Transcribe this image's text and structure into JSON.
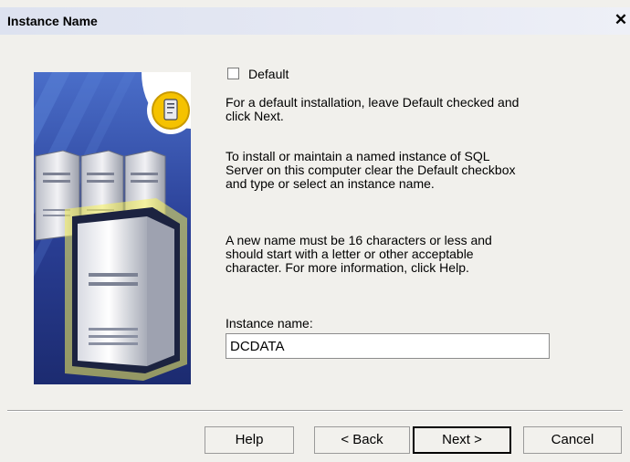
{
  "window": {
    "title": "Instance Name",
    "close_glyph": "✕"
  },
  "options": {
    "default_label": "Default",
    "default_checked": false
  },
  "text": {
    "p1": "For a default installation, leave Default checked and\nclick Next.",
    "p2": "To install or maintain a named instance of SQL\nServer on this computer clear the Default checkbox\nand type or select an instance name.",
    "p3": "A new name must be 16 characters or less and\nshould start with a letter or other acceptable\ncharacter.  For more information, click Help."
  },
  "instance": {
    "label": "Instance name:",
    "value": "DCDATA"
  },
  "buttons": {
    "help": "Help",
    "back": "< Back",
    "next": "Next >",
    "cancel": "Cancel"
  },
  "icons": {
    "art": "server-illustration",
    "badge": "server-badge-icon"
  },
  "colors": {
    "art_bg": "#2a3d8c",
    "badge": "#f5c200",
    "glow": "#f7f35a"
  }
}
